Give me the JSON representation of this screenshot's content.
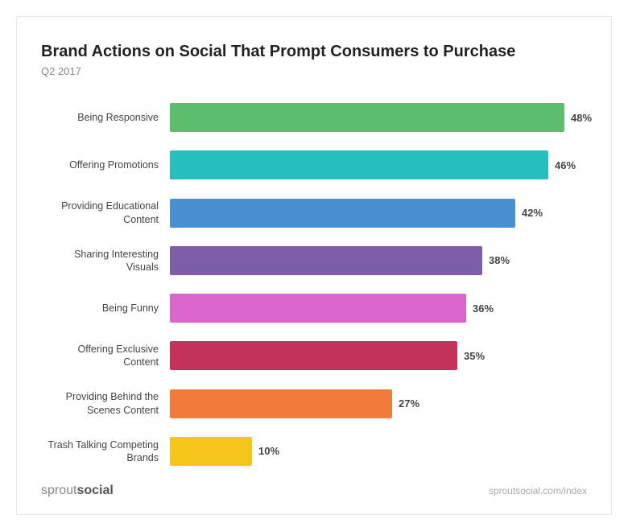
{
  "chart": {
    "title": "Brand Actions on Social That Prompt Consumers to Purchase",
    "subtitle": "Q2 2017",
    "max_value": 48,
    "track_width": 490,
    "bars": [
      {
        "label": "Being Responsive",
        "value": 48,
        "color": "#5cb85c",
        "color_hex": "#4CAF7D"
      },
      {
        "label": "Offering Promotions",
        "value": 46,
        "color": "#00bcd4",
        "color_hex": "#26C4C1"
      },
      {
        "label": "Providing Educational Content",
        "value": 42,
        "color": "#2196f3",
        "color_hex": "#3D8FE0"
      },
      {
        "label": "Sharing Interesting Visuals",
        "value": 38,
        "color": "#673ab7",
        "color_hex": "#7B5EA7"
      },
      {
        "label": "Being Funny",
        "value": 36,
        "color": "#e040fb",
        "color_hex": "#D966CC"
      },
      {
        "label": "Offering Exclusive Content",
        "value": 35,
        "color": "#c2185b",
        "color_hex": "#C2325A"
      },
      {
        "label": "Providing Behind the Scenes Content",
        "value": 27,
        "color": "#ff7043",
        "color_hex": "#F07B3A"
      },
      {
        "label": "Trash Talking Competing Brands",
        "value": 10,
        "color": "#fdd835",
        "color_hex": "#F5C518"
      }
    ]
  },
  "footer": {
    "brand_prefix": "sprout",
    "brand_suffix": "social",
    "url": "sproutsocial.com/index"
  }
}
